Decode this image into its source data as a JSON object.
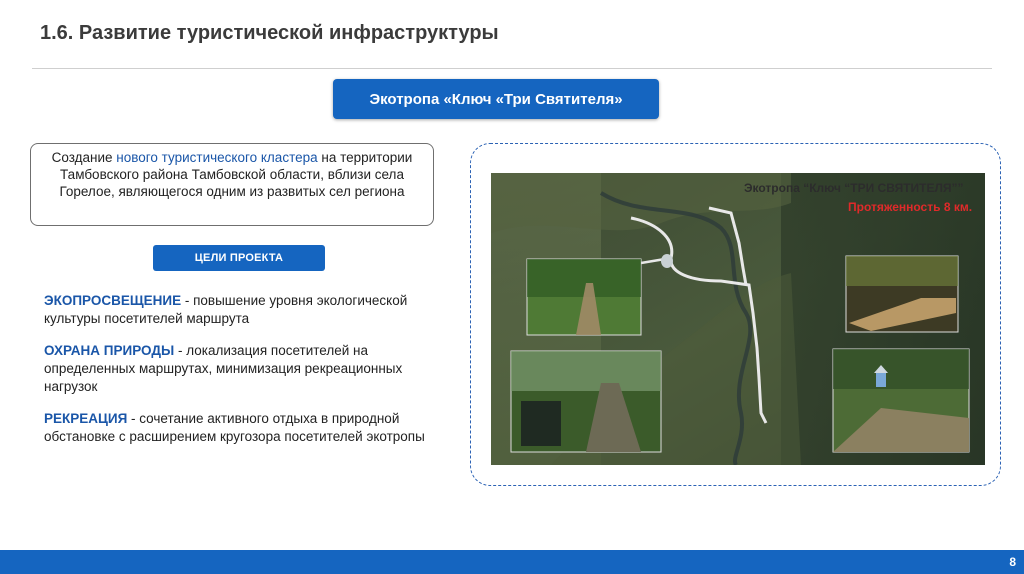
{
  "header": {
    "title": "1.6. Развитие туристической инфраструктуры"
  },
  "banner": {
    "label": "Экотропа «Ключ «Три Святителя»"
  },
  "intro": {
    "text_before": "Создание ",
    "highlight": "нового туристического кластера",
    "text_after": " на территории Тамбовского района Тамбовской области, вблизи села Горелое, являющегося одним из развитых сел региона"
  },
  "goals_button": {
    "label": "ЦЕЛИ ПРОЕКТА"
  },
  "goals": [
    {
      "title": "ЭКОПРОСВЕЩЕНИЕ",
      "text": " - повышение уровня экологической культуры посетителей маршрута"
    },
    {
      "title": "ОХРАНА ПРИРОДЫ",
      "text": " - локализация посетителей на определенных маршрутах, минимизация рекреационных нагрузок"
    },
    {
      "title": "РЕКРЕАЦИЯ",
      "text": " - сочетание активного отдыха в природной обстановке с расширением кругозора посетителей экотропы"
    }
  ],
  "map": {
    "title": "Экотропа “Ключ “ТРИ СВЯТИТЕЛЯ””",
    "subtitle": "Протяженность 8 км."
  },
  "footer": {
    "page_number": "8"
  },
  "colors": {
    "accent": "#1565c0",
    "highlight_text": "#1a56a8",
    "map_subtitle": "#e02a2a"
  }
}
